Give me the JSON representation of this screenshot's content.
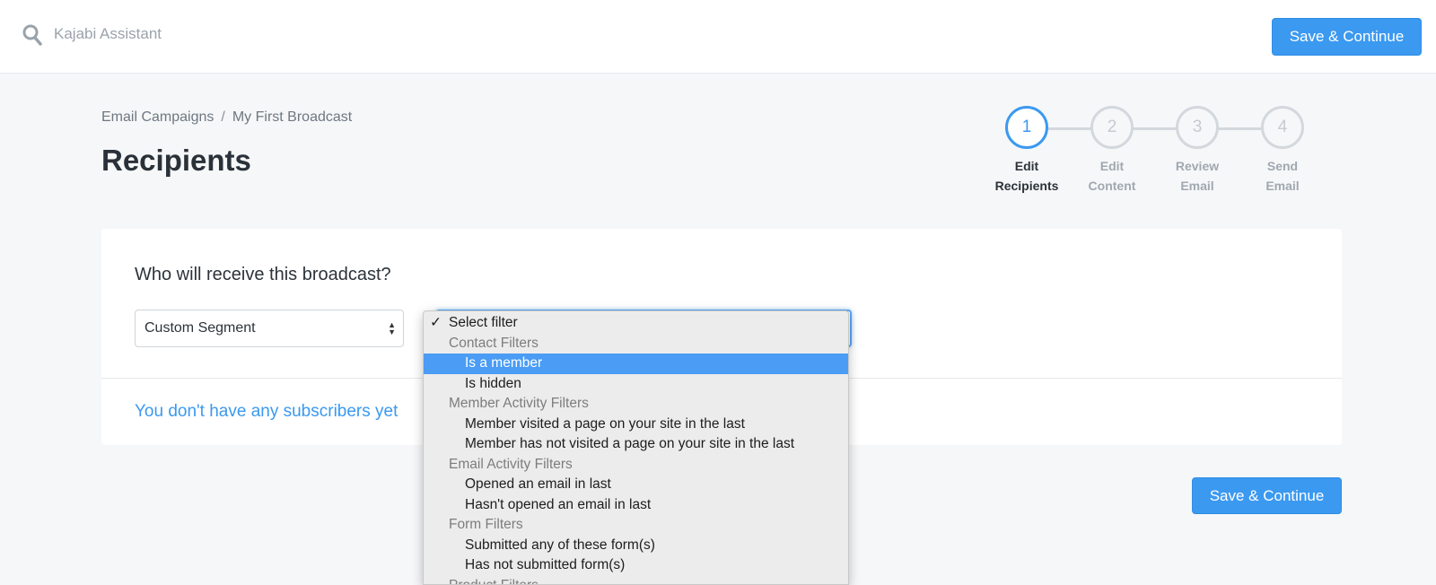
{
  "header": {
    "search_placeholder": "Kajabi Assistant",
    "save_label": "Save & Continue"
  },
  "breadcrumb": [
    "Email Campaigns",
    "My First Broadcast"
  ],
  "breadcrumb_separator": "/",
  "page_title": "Recipients",
  "stepper": [
    {
      "number": "1",
      "line1": "Edit",
      "line2": "Recipients",
      "active": true
    },
    {
      "number": "2",
      "line1": "Edit",
      "line2": "Content",
      "active": false
    },
    {
      "number": "3",
      "line1": "Review",
      "line2": "Email",
      "active": false
    },
    {
      "number": "4",
      "line1": "Send",
      "line2": "Email",
      "active": false
    }
  ],
  "card": {
    "question": "Who will receive this broadcast?",
    "segment_value": "Custom Segment",
    "empty_message": "You don't have any subscribers yet"
  },
  "dropdown": {
    "checked_option": "Select filter",
    "items": [
      {
        "kind": "top",
        "label": "Select filter",
        "checked": true
      },
      {
        "kind": "group",
        "label": "Contact Filters"
      },
      {
        "kind": "opt",
        "label": "Is a member",
        "selected": true
      },
      {
        "kind": "opt",
        "label": "Is hidden"
      },
      {
        "kind": "group",
        "label": "Member Activity Filters"
      },
      {
        "kind": "opt",
        "label": "Member visited a page on your site in the last"
      },
      {
        "kind": "opt",
        "label": "Member has not visited a page on your site in the last"
      },
      {
        "kind": "group",
        "label": "Email Activity Filters"
      },
      {
        "kind": "opt",
        "label": "Opened an email in last"
      },
      {
        "kind": "opt",
        "label": "Hasn't opened an email in last"
      },
      {
        "kind": "group",
        "label": "Form Filters"
      },
      {
        "kind": "opt",
        "label": "Submitted any of these form(s)"
      },
      {
        "kind": "opt",
        "label": "Has not submitted form(s)"
      },
      {
        "kind": "group",
        "label": "Product Filters"
      }
    ]
  },
  "footer": {
    "save_label": "Save & Continue"
  },
  "colors": {
    "accent": "#3b99f0",
    "selected_option": "#4a9cf5"
  }
}
